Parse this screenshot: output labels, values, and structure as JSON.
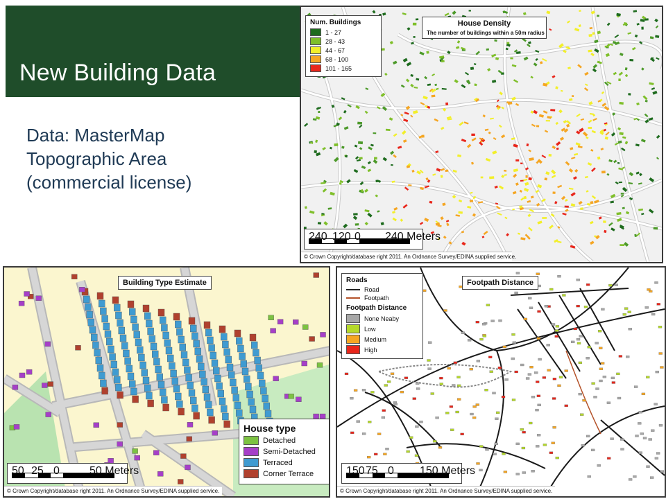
{
  "slide": {
    "title": "New Building Data",
    "note_lines": [
      "Data: MasterMap",
      "Topographic  Area",
      "(commercial license)"
    ],
    "colors": {
      "title_band": "#1f4d2a",
      "note_text": "#1f3a55"
    }
  },
  "maps": {
    "house_density": {
      "title": "House Density",
      "subtitle": "The number of buildings within a 50m radius",
      "legend": {
        "title": "Num. Buildings",
        "items": [
          {
            "label": "1 - 27",
            "color": "#1e6b1e"
          },
          {
            "label": "28 - 43",
            "color": "#7fbf2a"
          },
          {
            "label": "44 - 67",
            "color": "#f2ef2a"
          },
          {
            "label": "68 - 100",
            "color": "#f5a623"
          },
          {
            "label": "101 - 165",
            "color": "#e8261b"
          }
        ]
      },
      "scale": {
        "labels": [
          "240",
          "120",
          "0",
          "240 Meters"
        ]
      },
      "copyright": "© Crown Copyright/database right 2011. An Ordnance Survey/EDINA supplied service."
    },
    "building_type": {
      "title": "Building Type Estimate",
      "legend": {
        "title": "House type",
        "items": [
          {
            "label": "Detached",
            "color": "#7cc242"
          },
          {
            "label": "Semi-Detached",
            "color": "#a63fc8"
          },
          {
            "label": "Terraced",
            "color": "#3f9bd1"
          },
          {
            "label": "Corner Terrace",
            "color": "#b0412e"
          }
        ]
      },
      "scale": {
        "labels": [
          "50",
          "25",
          "0",
          "50 Meters"
        ]
      },
      "copyright": "© Crown Copyright/database right 2011. An Ordnance Survey/EDINA supplied service."
    },
    "footpath_distance": {
      "title": "Footpath Distance",
      "legend": {
        "roads_title": "Roads",
        "roads": [
          {
            "label": "Road",
            "color": "#222222"
          },
          {
            "label": "Footpath",
            "color": "#b5532a"
          }
        ],
        "title": "Footpath Distance",
        "items": [
          {
            "label": "None Neaby",
            "color": "#a8a8a8"
          },
          {
            "label": "Low",
            "color": "#b5d92a"
          },
          {
            "label": "Medium",
            "color": "#f5a623"
          },
          {
            "label": "High",
            "color": "#e8261b"
          }
        ]
      },
      "scale": {
        "labels": [
          "150",
          "75",
          "0",
          "150 Meters"
        ]
      },
      "copyright": "© Crown Copyright/database right 2011. An Ordnance Survey/EDINA supplied service."
    }
  }
}
